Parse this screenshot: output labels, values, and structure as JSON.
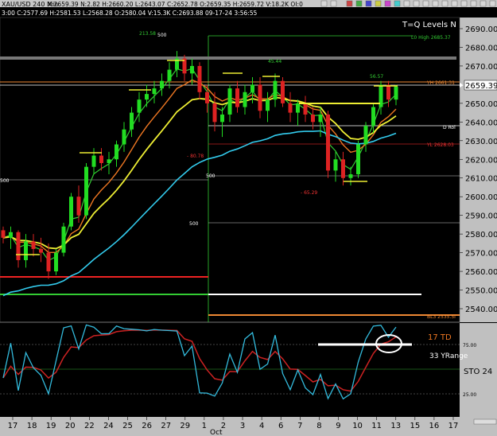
{
  "header": {
    "symbol_line": "XAU/USD  240 Min",
    "ohlc_line": "3:00  C:2577.69  H:2581.53  L:2568.28  O:2580.04  V:15.3K  C:2693.88  09-17-24  3:56:55",
    "info_line": "X:2659.39  N:2.82  H:2660.20  L:2643.07  C:2652.78  O:2659.35  H:2659.72  V:18.2K  OI:0"
  },
  "labels": {
    "tq_levels": "T=Q Levels N",
    "current_price": "2659.39",
    "lo_high": "L0 High 2685.37",
    "yh": "YH 2661.31",
    "d_rol": "D Rol",
    "yl": "YL 2628.03",
    "bl3": "BL3 2535.5I",
    "peak_val": "213.58",
    "val_4544": "45.44",
    "val_5657": "56.57",
    "val_8078": "- 80.78",
    "val_6529": "- 65.29",
    "m500_a": "500",
    "m500_b": "500",
    "m500_c": "500",
    "m500_d": "500",
    "td_label": "17 TD",
    "yrange_label": "33 YRange",
    "sto_label": "STO  24",
    "osc_75": "75.00",
    "osc_25": "25.00",
    "month": "Oct"
  },
  "price_axis": [
    "2690.00",
    "2680.00",
    "2670.00",
    "2660.00",
    "2650.00",
    "2640.00",
    "2630.00",
    "2620.00",
    "2610.00",
    "2600.00",
    "2590.00",
    "2580.00",
    "2570.00",
    "2560.00",
    "2550.00",
    "2540.00"
  ],
  "date_axis": [
    "17",
    "18",
    "19",
    "20",
    "22",
    "24",
    "25",
    "26",
    "27",
    "29",
    "1",
    "2",
    "3",
    "4",
    "6",
    "7",
    "8",
    "9",
    "10",
    "11",
    "13",
    "15",
    "16",
    "17"
  ],
  "colors": {
    "up": "#22dd22",
    "down": "#dd2222",
    "cyan": "#33ccee",
    "yellow": "#eeee33",
    "orange": "#ee7722",
    "green": "#33cc33",
    "red": "#ee2222",
    "stoch": "#33bbdd",
    "stoch_signal": "#cc2222"
  },
  "chart_data": {
    "type": "candlestick",
    "title": "",
    "ylim": [
      2535,
      2695
    ],
    "horizontal_levels": [
      {
        "label": "L0 High 2685.37",
        "value": 2685.37
      },
      {
        "label": "YH 2661.31",
        "value": 2661.31
      },
      {
        "label": "YL 2628.03",
        "value": 2628.03
      },
      {
        "label": "BL3 2535.5I",
        "value": 2535.5
      }
    ],
    "candles": [
      [
        2582,
        2584,
        2575,
        2578
      ],
      [
        2578,
        2584,
        2572,
        2581
      ],
      [
        2581,
        2582,
        2562,
        2566
      ],
      [
        2566,
        2580,
        2562,
        2576
      ],
      [
        2576,
        2580,
        2568,
        2572
      ],
      [
        2572,
        2578,
        2565,
        2570
      ],
      [
        2570,
        2575,
        2556,
        2560
      ],
      [
        2560,
        2572,
        2558,
        2570
      ],
      [
        2570,
        2586,
        2568,
        2584
      ],
      [
        2584,
        2602,
        2582,
        2600
      ],
      [
        2600,
        2606,
        2586,
        2590
      ],
      [
        2590,
        2618,
        2588,
        2616
      ],
      [
        2616,
        2626,
        2612,
        2622
      ],
      [
        2622,
        2626,
        2614,
        2618
      ],
      [
        2618,
        2624,
        2612,
        2620
      ],
      [
        2620,
        2630,
        2616,
        2628
      ],
      [
        2628,
        2640,
        2624,
        2636
      ],
      [
        2636,
        2648,
        2632,
        2645
      ],
      [
        2645,
        2656,
        2640,
        2652
      ],
      [
        2652,
        2660,
        2648,
        2655
      ],
      [
        2655,
        2662,
        2650,
        2658
      ],
      [
        2658,
        2666,
        2654,
        2662
      ],
      [
        2662,
        2672,
        2658,
        2668
      ],
      [
        2668,
        2678,
        2664,
        2674
      ],
      [
        2674,
        2676,
        2662,
        2666
      ],
      [
        2666,
        2674,
        2660,
        2670
      ],
      [
        2670,
        2672,
        2652,
        2656
      ],
      [
        2656,
        2660,
        2645,
        2650
      ],
      [
        2650,
        2656,
        2635,
        2640
      ],
      [
        2640,
        2648,
        2632,
        2644
      ],
      [
        2644,
        2660,
        2640,
        2658
      ],
      [
        2658,
        2662,
        2645,
        2648
      ],
      [
        2648,
        2660,
        2644,
        2656
      ],
      [
        2656,
        2664,
        2650,
        2660
      ],
      [
        2660,
        2664,
        2642,
        2646
      ],
      [
        2646,
        2656,
        2640,
        2652
      ],
      [
        2652,
        2666,
        2648,
        2662
      ],
      [
        2662,
        2664,
        2648,
        2650
      ],
      [
        2650,
        2656,
        2640,
        2645
      ],
      [
        2645,
        2652,
        2638,
        2650
      ],
      [
        2650,
        2654,
        2640,
        2644
      ],
      [
        2644,
        2648,
        2636,
        2640
      ],
      [
        2640,
        2648,
        2632,
        2644
      ],
      [
        2644,
        2646,
        2610,
        2614
      ],
      [
        2614,
        2624,
        2608,
        2620
      ],
      [
        2620,
        2624,
        2606,
        2610
      ],
      [
        2610,
        2616,
        2606,
        2612
      ],
      [
        2612,
        2630,
        2610,
        2628
      ],
      [
        2628,
        2640,
        2624,
        2638
      ],
      [
        2638,
        2650,
        2634,
        2648
      ],
      [
        2648,
        2662,
        2644,
        2660
      ],
      [
        2660,
        2662,
        2648,
        2652
      ],
      [
        2652,
        2660,
        2649,
        2659
      ]
    ]
  }
}
